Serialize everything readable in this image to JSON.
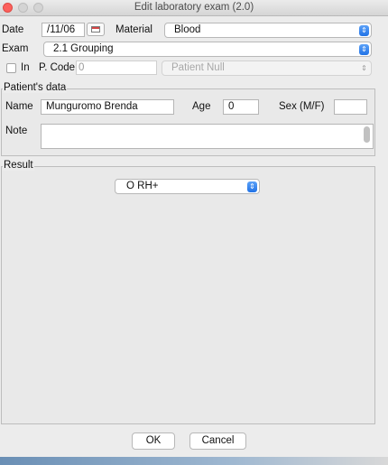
{
  "window": {
    "title": "Edit laboratory exam (2.0)"
  },
  "form": {
    "date_label": "Date",
    "date_value": "/11/06",
    "material_label": "Material",
    "material_value": "Blood",
    "exam_label": "Exam",
    "exam_value": "2.1 Grouping",
    "in_label": "In",
    "pcode_label": "P. Code",
    "pcode_value": "0",
    "patient_select_value": "Patient Null"
  },
  "patient": {
    "section_title": "Patient's data",
    "name_label": "Name",
    "name_value": "Munguromo Brenda",
    "age_label": "Age",
    "age_value": "0",
    "sex_label": "Sex (M/F)",
    "sex_value": "",
    "note_label": "Note",
    "note_value": ""
  },
  "result": {
    "section_title": "Result",
    "value": "O RH+"
  },
  "buttons": {
    "ok": "OK",
    "cancel": "Cancel"
  },
  "colors": {
    "accent": "#2273e6",
    "window_bg": "#ececec",
    "close": "#fc605c"
  }
}
